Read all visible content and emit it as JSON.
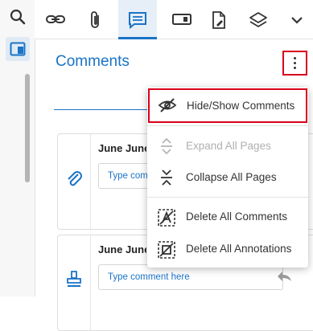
{
  "left_rail": {
    "search_icon": "search-icon",
    "panel_icon": "panel-icon"
  },
  "toolbar": {
    "items": [
      {
        "name": "link-icon"
      },
      {
        "name": "attachment-icon"
      },
      {
        "name": "comments-icon",
        "active": true
      },
      {
        "name": "form-field-icon"
      },
      {
        "name": "sign-document-icon"
      },
      {
        "name": "layers-icon"
      },
      {
        "name": "chevron-down-icon"
      }
    ]
  },
  "panel": {
    "title": "Comments"
  },
  "cards": [
    {
      "icon": "paperclip-icon",
      "date": "June June",
      "placeholder": "Type comment here"
    },
    {
      "icon": "stamp-icon",
      "date": "June June",
      "placeholder": "Type comment here"
    }
  ],
  "menu": {
    "items": [
      {
        "label": "Hide/Show Comments",
        "icon": "eye-slash-icon",
        "enabled": true,
        "highlighted": true
      },
      {
        "label": "Expand All Pages",
        "icon": "expand-icon",
        "enabled": false
      },
      {
        "label": "Collapse All Pages",
        "icon": "collapse-icon",
        "enabled": true
      },
      {
        "label": "Delete All Comments",
        "icon": "delete-comments-icon",
        "enabled": true
      },
      {
        "label": "Delete All Annotations",
        "icon": "delete-annotations-icon",
        "enabled": true
      }
    ]
  },
  "colors": {
    "accent": "#1a73c7",
    "highlight_border": "#d9001b"
  }
}
